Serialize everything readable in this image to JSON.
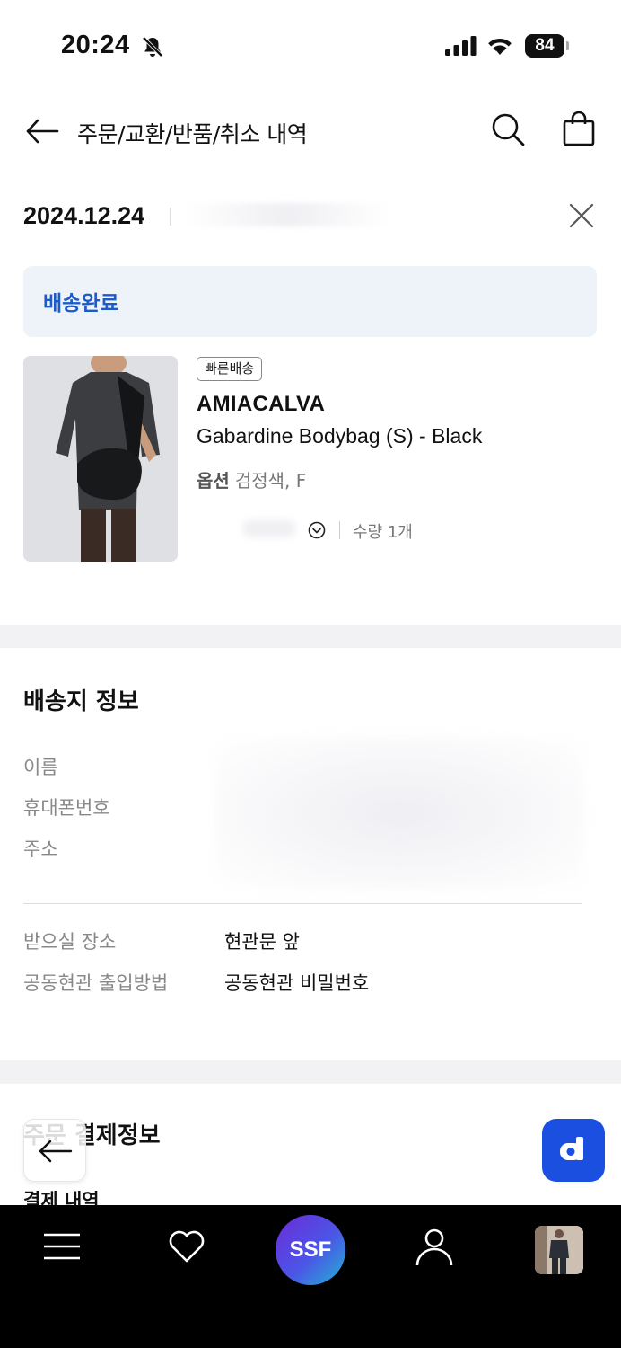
{
  "status_bar": {
    "time": "20:24",
    "battery": "84"
  },
  "header": {
    "title": "주문/교환/반품/취소 내역"
  },
  "order": {
    "date": "2024.12.24",
    "status": "배송완료"
  },
  "product": {
    "badge": "빠른배송",
    "brand": "AMIACALVA",
    "name": "Gabardine Bodybag (S) - Black",
    "option_label": "옵션",
    "option_value": "검정색, F",
    "quantity": "수량 1개"
  },
  "shipping": {
    "title": "배송지 정보",
    "labels": {
      "name": "이름",
      "phone": "휴대폰번호",
      "address": "주소",
      "place": "받으실 장소",
      "entrance": "공동현관 출입방법"
    },
    "values": {
      "place": "현관문 앞",
      "entrance": "공동현관 비밀번호"
    }
  },
  "payment": {
    "title": "주문 결제정보",
    "subtitle": "결제 내역"
  },
  "bottom_nav": {
    "ssf_label": "SSF",
    "items": [
      "menu-icon",
      "heart-icon",
      "ssf-home",
      "user-icon",
      "recent-item"
    ]
  },
  "colors": {
    "accent": "#1d5cc8",
    "status_bg": "#eef3f9",
    "chat_button": "#1a4fe0",
    "nav_bg": "#000000"
  }
}
